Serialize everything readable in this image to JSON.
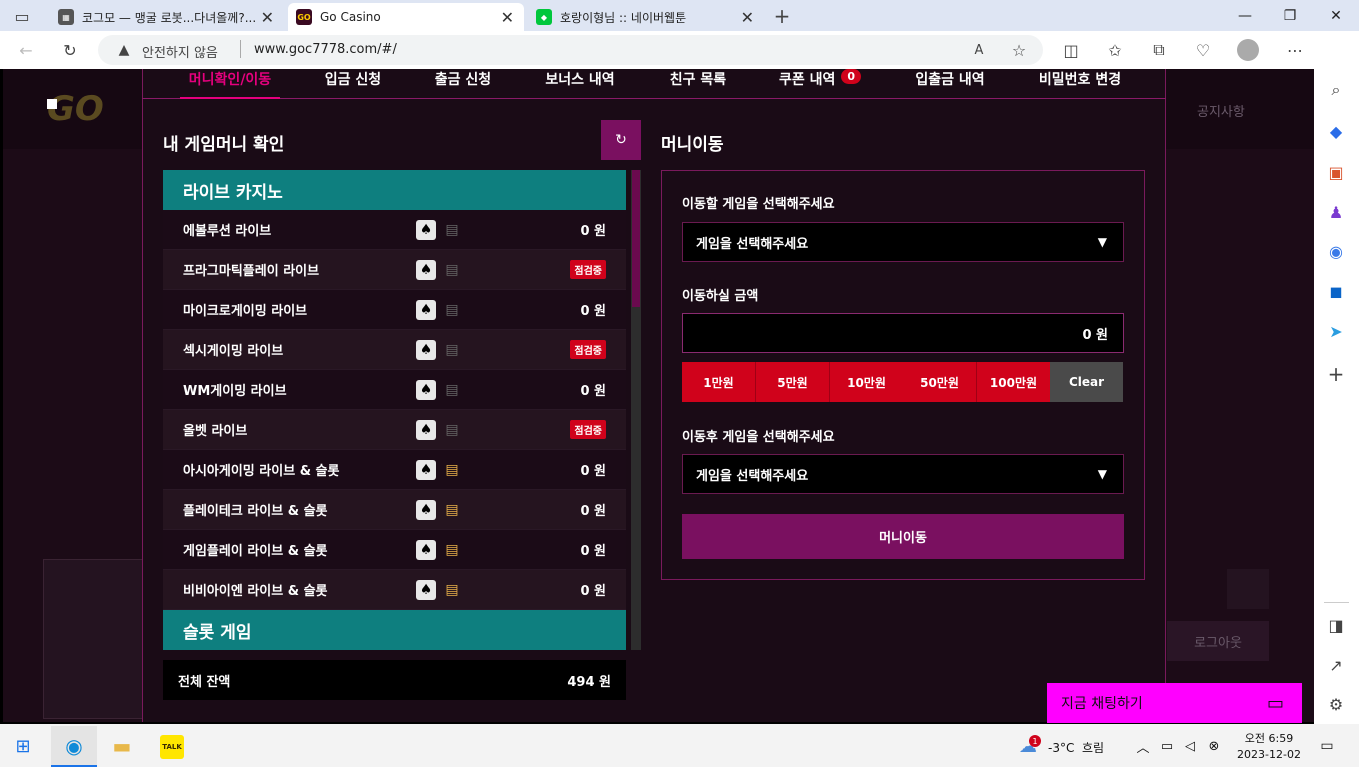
{
  "browser": {
    "tabs": [
      {
        "title": "코그모 — 맹굴 로봇...다녀올께?..."
      },
      {
        "title": "Go Casino"
      },
      {
        "title": "호랑이형님 :: 네이버웹툰"
      }
    ],
    "security_label": "안전하지 않음",
    "url": "www.goc7778.com/#/"
  },
  "site": {
    "header_link": "공지사항",
    "logout": "로그아웃"
  },
  "modal": {
    "tabs": [
      {
        "label": "머니확인/이동"
      },
      {
        "label": "입금 신청"
      },
      {
        "label": "출금 신청"
      },
      {
        "label": "보너스 내역"
      },
      {
        "label": "친구 목록"
      },
      {
        "label": "쿠폰 내역",
        "badge": "0"
      },
      {
        "label": "입출금 내역"
      },
      {
        "label": "비밀번호 변경"
      }
    ],
    "left_title": "내 게임머니 확인",
    "live_section": "라이브 카지노",
    "slot_section": "슬롯 게임",
    "games": [
      {
        "name": "에볼루션 라이브",
        "value": "0 원"
      },
      {
        "name": "프라그마틱플레이 라이브",
        "value": "점검중"
      },
      {
        "name": "마이크로게이밍 라이브",
        "value": "0 원"
      },
      {
        "name": "섹시게이밍 라이브",
        "value": "점검중"
      },
      {
        "name": "WM게이밍 라이브",
        "value": "0 원"
      },
      {
        "name": "올벳 라이브",
        "value": "점검중"
      },
      {
        "name": "아시아게이밍 라이브 & 슬롯",
        "value": "0 원"
      },
      {
        "name": "플레이테크 라이브 & 슬롯",
        "value": "0 원"
      },
      {
        "name": "게임플레이 라이브 & 슬롯",
        "value": "0 원"
      },
      {
        "name": "비비아이엔 라이브 & 슬롯",
        "value": "0 원"
      }
    ],
    "total_label": "전체 잔액",
    "total_value": "494 원",
    "right_title": "머니이동",
    "from_label": "이동할 게임을 선택해주세요",
    "from_select": "게임을 선택해주세요",
    "amount_label": "이동하실 금액",
    "amount_value": "0 원",
    "amount_buttons": [
      "1만원",
      "5만원",
      "10만원",
      "50만원",
      "100만원"
    ],
    "clear": "Clear",
    "to_label": "이동후 게임을 선택해주세요",
    "to_select": "게임을 선택해주세요",
    "submit": "머니이동"
  },
  "chat": {
    "label": "지금 채팅하기"
  },
  "taskbar": {
    "weather": "-3°C  흐림",
    "weather_badge": "1",
    "time": "오전 6:59",
    "date": "2023-12-02"
  }
}
